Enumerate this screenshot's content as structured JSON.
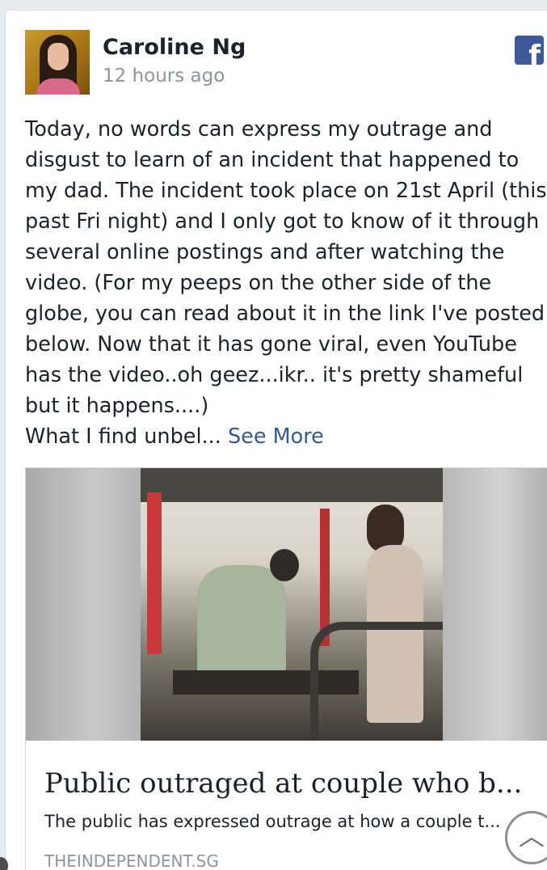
{
  "post": {
    "author": "Caroline Ng",
    "timestamp": "12 hours ago",
    "text": "Today, no words can express my outrage and disgust to learn of an incident that happened to my dad. The incident took place on 21st April (this past Fri night) and I only got to know of it through several online postings and after watching the video. (For my peeps on the other side of the globe, you can read about it in the link I've posted below. Now that it has gone viral, even YouTube has the video..oh geez...ikr.. it's pretty shameful but it happens....)\nWhat I find unbel... ",
    "see_more": "See More",
    "source_icon": "facebook-icon"
  },
  "link": {
    "title": "Public outraged at couple who b...",
    "description": "The public has expressed outrage at how a couple t...",
    "domain": "THEINDEPENDENT.SG"
  },
  "scroll_top_icon": "chevron-up-icon",
  "colors": {
    "facebook_blue": "#3b5998",
    "link_blue": "#365899",
    "meta_gray": "#90949c"
  }
}
